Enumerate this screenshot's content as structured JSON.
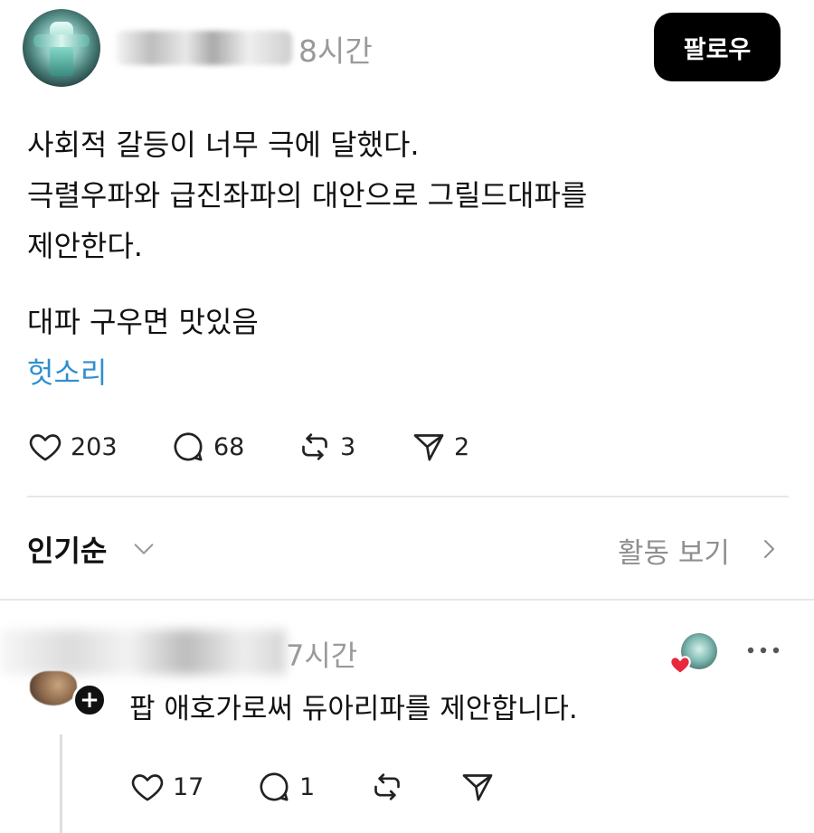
{
  "post": {
    "time": "8시간",
    "follow_label": "팔로우",
    "lines": [
      "사회적 갈등이 너무 극에 달했다.",
      "극렬우파와 급진좌파의 대안으로 그릴드대파를",
      "제안한다."
    ],
    "line_after_gap": "대파 구우면 맛있음",
    "hashtag": "헛소리",
    "actions": {
      "likes": "203",
      "comments": "68",
      "reposts": "3",
      "shares": "2"
    }
  },
  "sort": {
    "label": "인기순",
    "activity_label": "활동 보기"
  },
  "reply": {
    "time": "7시간",
    "text": "팝 애호가로써 듀아리파를 제안합니다.",
    "plus_glyph": "+",
    "actions": {
      "likes": "17",
      "comments": "1"
    }
  },
  "colors": {
    "hashtag": "#2f8fcf",
    "follow_bg": "#000000",
    "muted_text": "#9a9a9a",
    "heart_badge": "#e8283c"
  }
}
